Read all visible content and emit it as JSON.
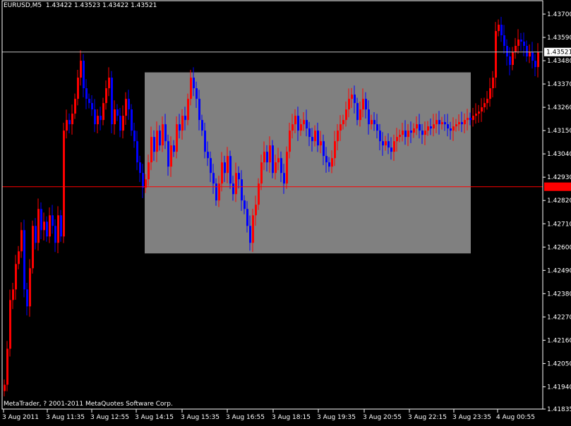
{
  "header": {
    "symbol": "EURUSD,M5",
    "ohlc": "1.43422 1.43523 1.43422 1.43521"
  },
  "footer": {
    "copyright": "MetaTrader, ? 2001-2011 MetaQuotes Software Corp."
  },
  "colors": {
    "background": "#000000",
    "bull": "#ff0000",
    "bear": "#0000ff",
    "doji": "#00c000",
    "rectangle": "#808080",
    "bid_line": "#c0c0c0",
    "level_line": "#ff0000",
    "text": "#ffffff"
  },
  "chart_data": {
    "type": "candlestick",
    "symbol": "EURUSD",
    "timeframe": "M5",
    "y_ticks": [
      "1.43700",
      "1.43590",
      "1.43480",
      "1.43370",
      "1.43260",
      "1.43150",
      "1.43040",
      "1.42930",
      "1.42820",
      "1.42710",
      "1.42600",
      "1.42490",
      "1.42380",
      "1.42270",
      "1.42160",
      "1.42050",
      "1.41940",
      "1.41835"
    ],
    "ylim": [
      1.41835,
      1.437
    ],
    "x_labels": [
      "3 Aug 2011",
      "3 Aug 11:35",
      "3 Aug 12:55",
      "3 Aug 14:15",
      "3 Aug 15:35",
      "3 Aug 16:55",
      "3 Aug 18:15",
      "3 Aug 19:35",
      "3 Aug 20:55",
      "3 Aug 22:15",
      "3 Aug 23:35",
      "4 Aug 00:55"
    ],
    "bid_label": "1.43521",
    "level_label": "1.42885",
    "levels": {
      "bid": 1.43521,
      "horizontal_line": 1.42885
    },
    "rectangle": {
      "price_top": 1.43425,
      "price_bottom": 1.4257,
      "start_bar": 50,
      "end_bar": 165
    },
    "bar_count": 190,
    "closes": [
      1.4195,
      1.4212,
      1.4235,
      1.424,
      1.4252,
      1.4258,
      1.4268,
      1.424,
      1.4232,
      1.425,
      1.427,
      1.4262,
      1.4278,
      1.4268,
      1.4272,
      1.4265,
      1.4275,
      1.427,
      1.4262,
      1.4275,
      1.4265,
      1.4315,
      1.432,
      1.4318,
      1.4323,
      1.433,
      1.434,
      1.4348,
      1.4335,
      1.433,
      1.4328,
      1.4325,
      1.4318,
      1.4322,
      1.432,
      1.4328,
      1.4335,
      1.434,
      1.4318,
      1.4325,
      1.4322,
      1.4315,
      1.4322,
      1.433,
      1.4325,
      1.4315,
      1.431,
      1.43,
      1.4295,
      1.4288,
      1.4292,
      1.43,
      1.4312,
      1.4305,
      1.4315,
      1.4308,
      1.4318,
      1.431,
      1.4298,
      1.4308,
      1.4305,
      1.4318,
      1.4315,
      1.4322,
      1.432,
      1.433,
      1.434,
      1.4335,
      1.433,
      1.432,
      1.4315,
      1.4305,
      1.4302,
      1.4295,
      1.429,
      1.4282,
      1.429,
      1.43,
      1.4295,
      1.4303,
      1.429,
      1.4285,
      1.4295,
      1.4292,
      1.4282,
      1.4278,
      1.427,
      1.4262,
      1.4275,
      1.428,
      1.429,
      1.43,
      1.4305,
      1.43,
      1.4308,
      1.4295,
      1.43,
      1.4302,
      1.4295,
      1.429,
      1.4305,
      1.4315,
      1.4318,
      1.4322,
      1.4315,
      1.4318,
      1.432,
      1.4316,
      1.4312,
      1.431,
      1.4315,
      1.4308,
      1.431,
      1.4303,
      1.43,
      1.4298,
      1.4302,
      1.431,
      1.4315,
      1.4318,
      1.432,
      1.4325,
      1.433,
      1.4332,
      1.4328,
      1.432,
      1.4325,
      1.433,
      1.4325,
      1.4318,
      1.432,
      1.4318,
      1.4315,
      1.431,
      1.4308,
      1.431,
      1.4307,
      1.4305,
      1.431,
      1.4312,
      1.4313,
      1.4315,
      1.4312,
      1.4315,
      1.4314,
      1.4316,
      1.4318,
      1.4315,
      1.4313,
      1.4315,
      1.4317,
      1.4316,
      1.4318,
      1.432,
      1.4318,
      1.4319,
      1.4318,
      1.4316,
      1.4315,
      1.4317,
      1.4318,
      1.4319,
      1.4318,
      1.432,
      1.4321,
      1.432,
      1.4322,
      1.4323,
      1.4324,
      1.4326,
      1.4328,
      1.433,
      1.4335,
      1.434,
      1.4362,
      1.4365,
      1.436,
      1.4355,
      1.435,
      1.4346,
      1.4352,
      1.4355,
      1.4358,
      1.4357,
      1.4355,
      1.435,
      1.4352,
      1.4348,
      1.4345,
      1.4352
    ]
  }
}
